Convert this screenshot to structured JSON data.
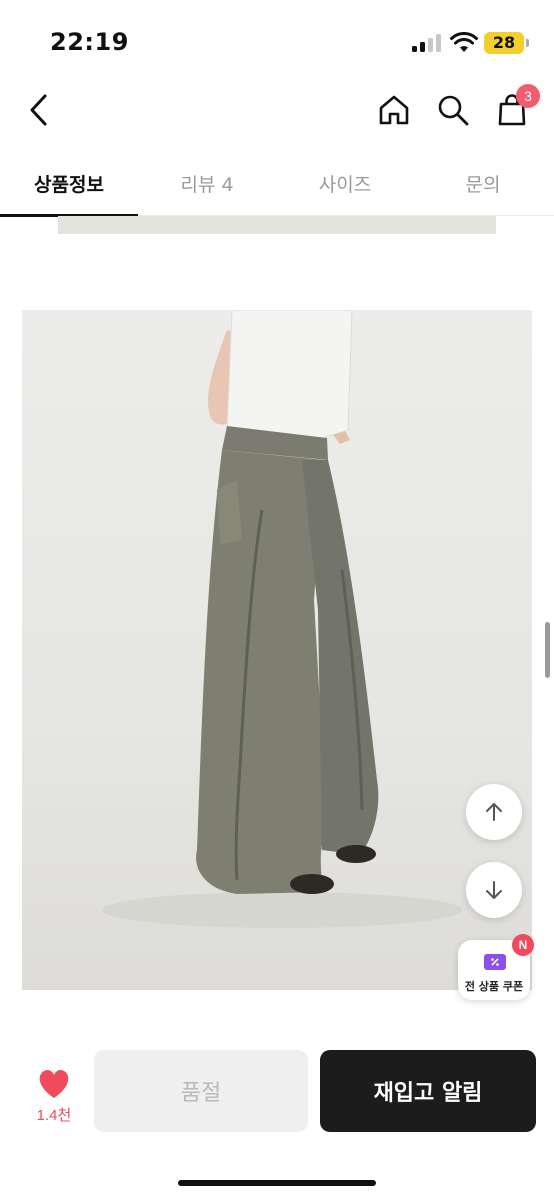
{
  "status_bar": {
    "time": "22:19",
    "battery": "28"
  },
  "header": {
    "cart_count": "3"
  },
  "tabs": [
    {
      "label": "상품정보"
    },
    {
      "label": "리뷰 4"
    },
    {
      "label": "사이즈"
    },
    {
      "label": "문의"
    }
  ],
  "coupon": {
    "label": "전 상품 쿠폰",
    "badge": "N"
  },
  "bottom": {
    "likes": "1.4천",
    "soldout_label": "품절",
    "restock_label": "재입고 알림"
  },
  "colors": {
    "accent_red": "#f04a5c",
    "cart_badge": "#f35d6b",
    "coupon_purple": "#8c4fe8",
    "primary_dark": "#1c1c1c"
  }
}
